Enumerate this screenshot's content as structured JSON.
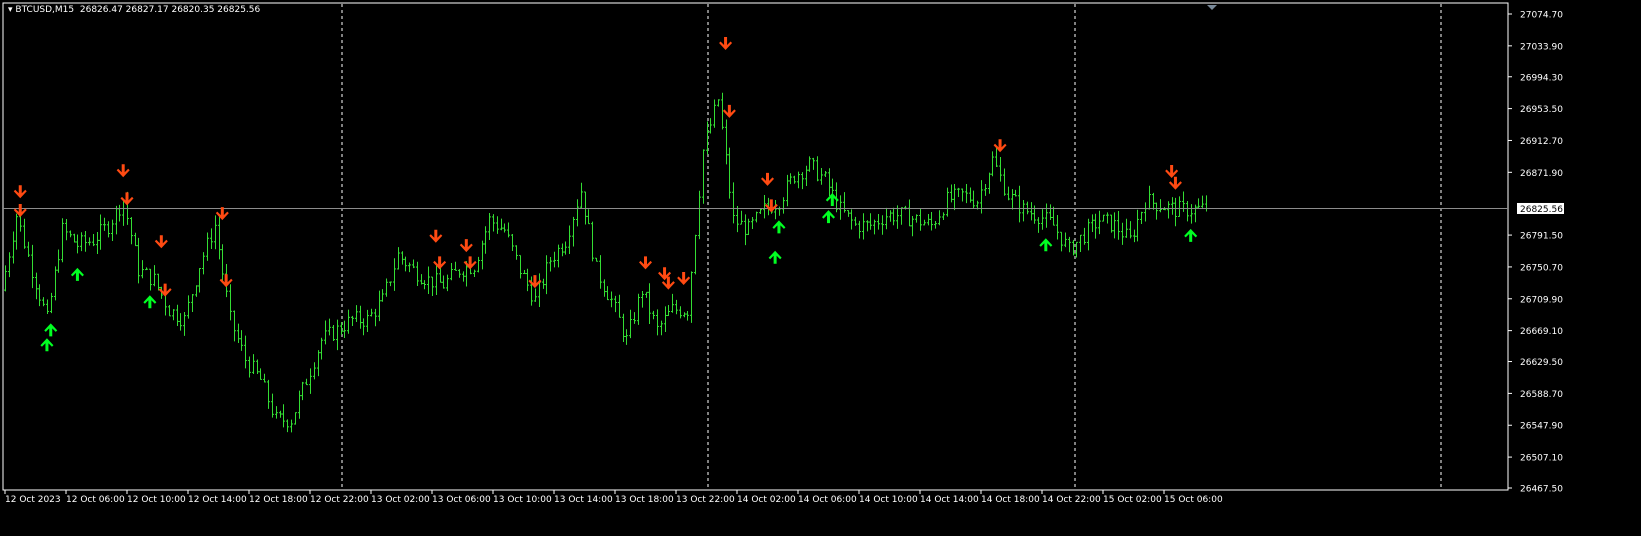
{
  "header": {
    "symbol": "BTCUSD,M15",
    "ohlc": "26826.47 26827.17 26820.35 26825.56"
  },
  "colors": {
    "background": "#000000",
    "bars": "#33dd33",
    "sell_arrow": "#ff4a12",
    "buy_arrow": "#00ff22",
    "grid_separator": "#ffffff",
    "bid_line": "#8c8c8c"
  },
  "chart_data": {
    "type": "ohlc",
    "timeframe": "M15",
    "price_axis": {
      "ylim": [
        26467.5,
        27074.7
      ],
      "ticks": [
        "27074.70",
        "27033.90",
        "26994.30",
        "26953.50",
        "26912.70",
        "26871.90",
        "26791.50",
        "26750.70",
        "26709.90",
        "26669.10",
        "26629.50",
        "26588.70",
        "26547.90",
        "26507.10",
        "26467.50"
      ],
      "current_price": "26825.56"
    },
    "time_axis": {
      "ticks": [
        "12 Oct 2023",
        "12 Oct 06:00",
        "12 Oct 10:00",
        "12 Oct 14:00",
        "12 Oct 18:00",
        "12 Oct 22:00",
        "13 Oct 02:00",
        "13 Oct 06:00",
        "13 Oct 10:00",
        "13 Oct 14:00",
        "13 Oct 18:00",
        "13 Oct 22:00",
        "14 Oct 02:00",
        "14 Oct 06:00",
        "14 Oct 10:00",
        "14 Oct 14:00",
        "14 Oct 18:00",
        "14 Oct 22:00",
        "15 Oct 02:00",
        "15 Oct 06:00"
      ]
    },
    "first_bar_time": "12 Oct 2023 00:00",
    "hourly_close": [
      26721,
      26817,
      26747,
      26683,
      26798,
      26779,
      26785,
      26804,
      26836,
      26747,
      26734,
      26696,
      26683,
      26753,
      26804,
      26683,
      26632,
      26606,
      26555,
      26555,
      26606,
      26657,
      26670,
      26683,
      26683,
      26708,
      26766,
      26747,
      26734,
      26728,
      26747,
      26753,
      26811,
      26798,
      26747,
      26708,
      26760,
      26785,
      26849,
      26747,
      26708,
      26657,
      26721,
      26670,
      26696,
      26696,
      26900,
      26965,
      26811,
      26798,
      26824,
      26836,
      26868,
      26881,
      26862,
      26824,
      26804,
      26804,
      26817,
      26817,
      26811,
      26804,
      26836,
      26843,
      26836,
      26888,
      26843,
      26824,
      26817,
      26804,
      26772,
      26792,
      26811,
      26804,
      26785,
      26836,
      26830,
      26824,
      26824,
      26825.56
    ],
    "sell_signals": [
      [
        "12 01:00",
        26845
      ],
      [
        "12 01:00",
        26821
      ],
      [
        "12 07:45",
        26872
      ],
      [
        "12 08:00",
        26836
      ],
      [
        "12 10:15",
        26781
      ],
      [
        "12 10:30",
        26719
      ],
      [
        "12 14:15",
        26817
      ],
      [
        "12 14:30",
        26731
      ],
      [
        "13 04:15",
        26788
      ],
      [
        "13 04:30",
        26754
      ],
      [
        "13 06:15",
        26776
      ],
      [
        "13 06:30",
        26754
      ],
      [
        "13 10:45",
        26730
      ],
      [
        "13 18:00",
        26754
      ],
      [
        "13 19:15",
        26740
      ],
      [
        "13 19:30",
        26728
      ],
      [
        "13 20:30",
        26734
      ],
      [
        "13 23:15",
        27035
      ],
      [
        "13 23:30",
        26948
      ],
      [
        "14 02:00",
        26861
      ],
      [
        "14 02:15",
        26827
      ],
      [
        "14 17:15",
        26904
      ],
      [
        "15 04:30",
        26871
      ],
      [
        "15 04:45",
        26856
      ]
    ],
    "buy_signals": [
      [
        "12 02:45",
        26653
      ],
      [
        "12 03:00",
        26672
      ],
      [
        "12 04:45",
        26743
      ],
      [
        "12 09:30",
        26708
      ],
      [
        "14 02:30",
        26765
      ],
      [
        "14 02:45",
        26804
      ],
      [
        "14 06:00",
        26817
      ],
      [
        "14 06:15",
        26839
      ],
      [
        "14 20:15",
        26781
      ],
      [
        "15 05:45",
        26793
      ]
    ]
  }
}
